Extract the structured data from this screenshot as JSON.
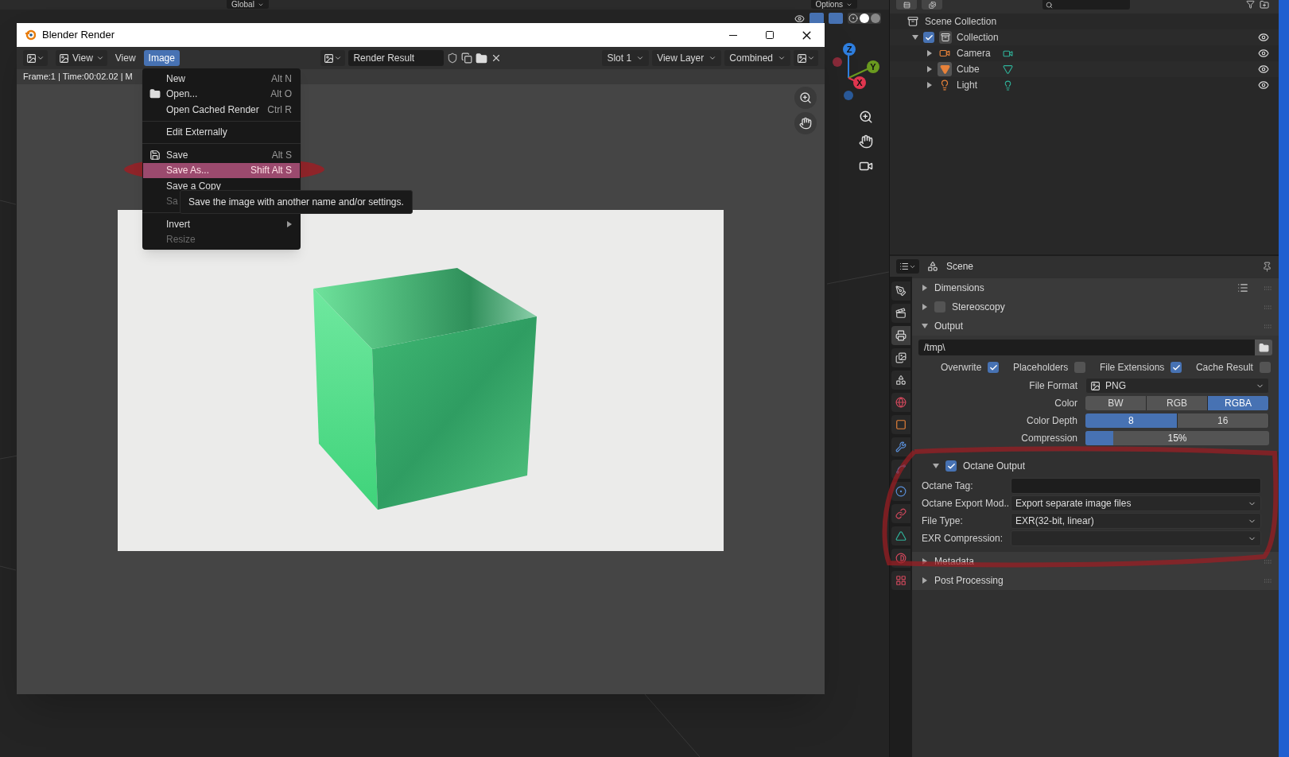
{
  "top_header": {
    "transform_orientation": "Global",
    "options": "Options"
  },
  "viewport": {
    "gizmo_axes": [
      {
        "label": "Z",
        "color": "#2f7fe0"
      },
      {
        "label": "Y",
        "color": "#6a9a1f"
      },
      {
        "label": "X",
        "color": "#e0364f"
      }
    ]
  },
  "render_window": {
    "title": "Blender Render",
    "view_dropdown": "View",
    "menus": [
      {
        "label": "View",
        "selected": false
      },
      {
        "label": "Image",
        "selected": true
      }
    ],
    "image_name": "Render Result",
    "dropdowns": [
      "Slot 1",
      "View Layer",
      "Combined"
    ],
    "info": "Frame:1 | Time:00:02.02 | M"
  },
  "image_menu": {
    "items": [
      {
        "kind": "item",
        "label": "New",
        "shortcut": "Alt N",
        "highlighted": false,
        "disabled": false
      },
      {
        "kind": "folder_item",
        "label": "Open...",
        "shortcut": "Alt O",
        "highlighted": false,
        "disabled": false
      },
      {
        "kind": "item",
        "label": "Open Cached Render",
        "shortcut": "Ctrl R",
        "highlighted": false,
        "disabled": false
      },
      {
        "kind": "separator"
      },
      {
        "kind": "item",
        "label": "Edit Externally",
        "highlighted": false,
        "disabled": false
      },
      {
        "kind": "separator"
      },
      {
        "kind": "save_item",
        "label": "Save",
        "shortcut": "Alt S",
        "highlighted": false,
        "disabled": false
      },
      {
        "kind": "item",
        "label": "Save As...",
        "shortcut": "Shift Alt S",
        "highlighted": true,
        "disabled": false
      },
      {
        "kind": "item",
        "label": "Save a Copy",
        "highlighted": false,
        "disabled": false
      },
      {
        "kind": "item",
        "label": "Sa",
        "highlighted": false,
        "disabled": true
      },
      {
        "kind": "separator"
      },
      {
        "kind": "submenu",
        "label": "Invert",
        "highlighted": false,
        "disabled": false
      },
      {
        "kind": "item",
        "label": "Resize",
        "highlighted": false,
        "disabled": true
      }
    ],
    "tooltip": "Save the image with another name and/or settings."
  },
  "outliner": {
    "tree": [
      {
        "label": "Scene Collection",
        "kind": "scene_collection",
        "children": [
          {
            "label": "Collection",
            "kind": "collection",
            "checked": true,
            "expanded": true,
            "visible": true,
            "children": [
              {
                "label": "Camera",
                "kind": "camera",
                "active": false,
                "visible": true
              },
              {
                "label": "Cube",
                "kind": "mesh",
                "active": true,
                "visible": true
              },
              {
                "label": "Light",
                "kind": "light",
                "active": false,
                "visible": true
              }
            ]
          }
        ]
      }
    ]
  },
  "properties": {
    "context": "Scene",
    "tabs": [
      {
        "kind": "tool",
        "selected": false
      },
      {
        "kind": "render",
        "selected": false
      },
      {
        "kind": "output",
        "selected": true
      },
      {
        "kind": "view_layer",
        "selected": false
      },
      {
        "kind": "scene",
        "selected": false
      },
      {
        "kind": "world",
        "selected": false
      },
      {
        "kind": "object",
        "selected": false
      },
      {
        "kind": "modifier",
        "selected": false
      },
      {
        "kind": "particles",
        "selected": false
      },
      {
        "kind": "physics",
        "selected": false
      },
      {
        "kind": "constraints",
        "selected": false
      },
      {
        "kind": "data",
        "selected": false
      },
      {
        "kind": "material",
        "selected": false
      },
      {
        "kind": "texture",
        "selected": false
      }
    ],
    "sections": [
      {
        "kind": "panel",
        "title": "Dimensions",
        "expanded": false,
        "presets": true
      },
      {
        "kind": "panel",
        "title": "Stereoscopy",
        "expanded": false,
        "checked": false
      },
      {
        "kind": "panel",
        "title": "Output",
        "expanded": true,
        "rows": [
          {
            "kind": "path",
            "value": "/tmp\\"
          },
          {
            "kind": "checkboxes",
            "items": [
              {
                "label": "Overwrite",
                "checked": true
              },
              {
                "label": "Placeholders",
                "checked": false
              },
              {
                "label": "File Extensions",
                "checked": true
              },
              {
                "label": "Cache Result",
                "checked": false
              }
            ]
          },
          {
            "kind": "dropdown",
            "label": "File Format",
            "value": "PNG",
            "icon": true
          },
          {
            "kind": "toggles",
            "label": "Color",
            "options": [
              {
                "label": "BW",
                "selected": false
              },
              {
                "label": "RGB",
                "selected": false
              },
              {
                "label": "RGBA",
                "selected": true
              }
            ]
          },
          {
            "kind": "toggles",
            "label": "Color Depth",
            "options": [
              {
                "label": "8",
                "selected": true
              },
              {
                "label": "16",
                "selected": false
              }
            ]
          },
          {
            "kind": "slider",
            "label": "Compression",
            "value": "15%",
            "level": 0.15
          }
        ]
      },
      {
        "kind": "subpanel",
        "title": "Octane Output",
        "expanded": true,
        "checked": true,
        "rows": [
          {
            "kind": "text",
            "label": "Octane Tag:"
          },
          {
            "kind": "dropdown",
            "label": "Octane Export Mod..",
            "value": "Export separate image files"
          },
          {
            "kind": "dropdown",
            "label": "File Type:",
            "value": "EXR(32-bit, linear)"
          },
          {
            "kind": "dropdown",
            "label": "EXR Compression:"
          }
        ]
      },
      {
        "kind": "panel",
        "title": "Metadata",
        "expanded": false
      },
      {
        "kind": "panel",
        "title": "Post Processing",
        "expanded": false
      }
    ]
  }
}
